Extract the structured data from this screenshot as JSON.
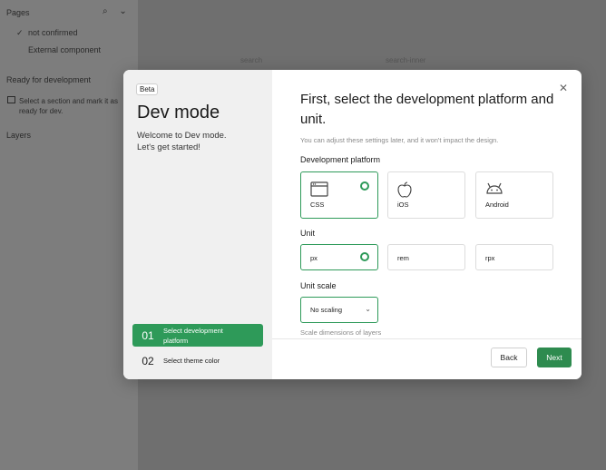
{
  "background": {
    "pages_title": "Pages",
    "check_mark": "✓",
    "page_not_confirmed": "not confirmed",
    "page_external": "External component",
    "ready_title": "Ready for development",
    "ready_hint": "Select a section and mark it as ready for dev.",
    "layers_title": "Layers",
    "search_a": "search",
    "search_b": "search-inner"
  },
  "modal": {
    "badge": "Beta",
    "title": "Dev mode",
    "subtitle_line1": "Welcome to Dev mode.",
    "subtitle_line2": "Let's get started!",
    "steps": [
      {
        "num": "01",
        "label": "Select development platform"
      },
      {
        "num": "02",
        "label": "Select theme color"
      }
    ],
    "close_glyph": "✕",
    "heading": "First, select the development platform and unit.",
    "hint": "You can adjust these settings later, and it won't impact the design.",
    "platform_label": "Development platform",
    "platforms": [
      {
        "label": "CSS",
        "icon": "browser-window-icon"
      },
      {
        "label": "iOS",
        "icon": "apple-icon"
      },
      {
        "label": "Android",
        "icon": "android-icon"
      }
    ],
    "selected_platform": "CSS",
    "unit_label": "Unit",
    "units": [
      {
        "label": "px"
      },
      {
        "label": "rem"
      },
      {
        "label": "rpx"
      }
    ],
    "selected_unit": "px",
    "scale_label": "Unit scale",
    "scale_value": "No scaling",
    "scale_hint": "Scale dimensions of layers",
    "back_label": "Back",
    "next_label": "Next"
  },
  "colors": {
    "accent": "#2e9a59",
    "next_button": "#2e8b4f"
  }
}
